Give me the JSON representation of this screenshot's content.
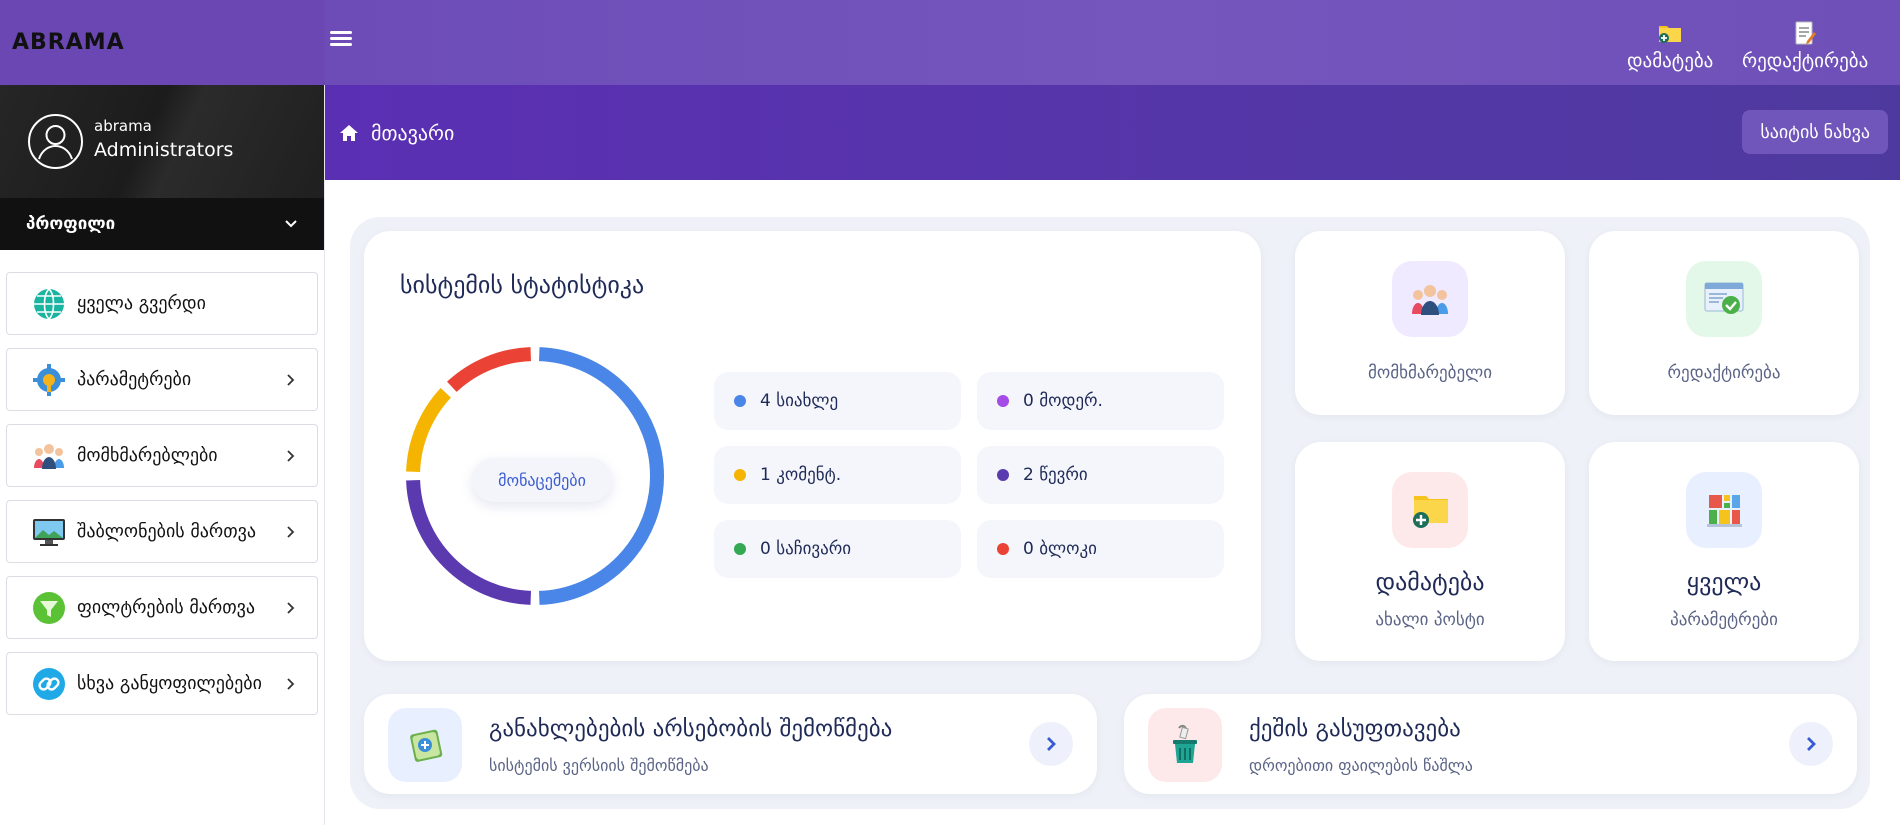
{
  "brand": {
    "name": "ABRAMA"
  },
  "topbar": {
    "actions": [
      {
        "label": "დამატება",
        "icon": "folder-add-icon"
      },
      {
        "label": "რედაქტირება",
        "icon": "document-edit-icon"
      }
    ]
  },
  "user": {
    "name": "abrama",
    "role": "Administrators"
  },
  "profile": {
    "label": "პროფილი"
  },
  "sidebar": {
    "items": [
      {
        "label": "ყველა გვერდი",
        "icon": "globe-icon",
        "has_arrow": false
      },
      {
        "label": "პარამეტრები",
        "icon": "settings-gear-icon",
        "has_arrow": true
      },
      {
        "label": "მომხმარებლები",
        "icon": "users-icon",
        "has_arrow": true
      },
      {
        "label": "შაბლონების მართვა",
        "icon": "monitor-icon",
        "has_arrow": true
      },
      {
        "label": "ფილტრების მართვა",
        "icon": "filter-icon",
        "has_arrow": true
      },
      {
        "label": "სხვა განყოფილებები",
        "icon": "link-icon",
        "has_arrow": true
      }
    ]
  },
  "header": {
    "breadcrumb": "მთავარი",
    "site_view_button": "საიტის ნახვა"
  },
  "stats": {
    "title": "სისტემის სტატისტიკა",
    "center_label": "მონაცემები",
    "items": [
      {
        "label": "4 სიახლე",
        "color": "#4a86e8"
      },
      {
        "label": "0 მოდერ.",
        "color": "#a54be6"
      },
      {
        "label": "1 კომენტ.",
        "color": "#f4b400"
      },
      {
        "label": "2 წევრი",
        "color": "#5b3ab0"
      },
      {
        "label": "0 საჩივარი",
        "color": "#34a853"
      },
      {
        "label": "0 ბლოკი",
        "color": "#ea4335"
      }
    ]
  },
  "chart_data": {
    "type": "pie",
    "categories": [
      "სიახლე",
      "წევრი",
      "კომენტ.",
      "ბლოკი"
    ],
    "values": [
      4,
      2,
      1,
      1
    ],
    "colors": [
      "#4a86e8",
      "#5b3ab0",
      "#f4b400",
      "#ea4335"
    ],
    "title": "",
    "center_label": "მონაცემები"
  },
  "tiles": {
    "users": {
      "label": "მომხმარებელი",
      "icon": "users-group-icon",
      "bg": "#efeaff"
    },
    "editing": {
      "label": "რედაქტირება",
      "icon": "browser-check-icon",
      "bg": "#e3f8e8"
    },
    "add": {
      "title": "დამატება",
      "label": "ახალი პოსტი",
      "icon": "folder-add-icon",
      "bg": "#fde9ea"
    },
    "all": {
      "title": "ყველა",
      "label": "პარამეტრები",
      "icon": "grid-blocks-icon",
      "bg": "#e8efff"
    }
  },
  "actions": {
    "updates": {
      "title": "განახლებების არსებობის შემოწმება",
      "subtitle": "სისტემის ვერსიის შემოწმება",
      "icon": "update-box-icon"
    },
    "cache": {
      "title": "ქეშის გასუფთავება",
      "subtitle": "დროებითი ფაილების წაშლა",
      "icon": "trash-bin-icon"
    }
  }
}
